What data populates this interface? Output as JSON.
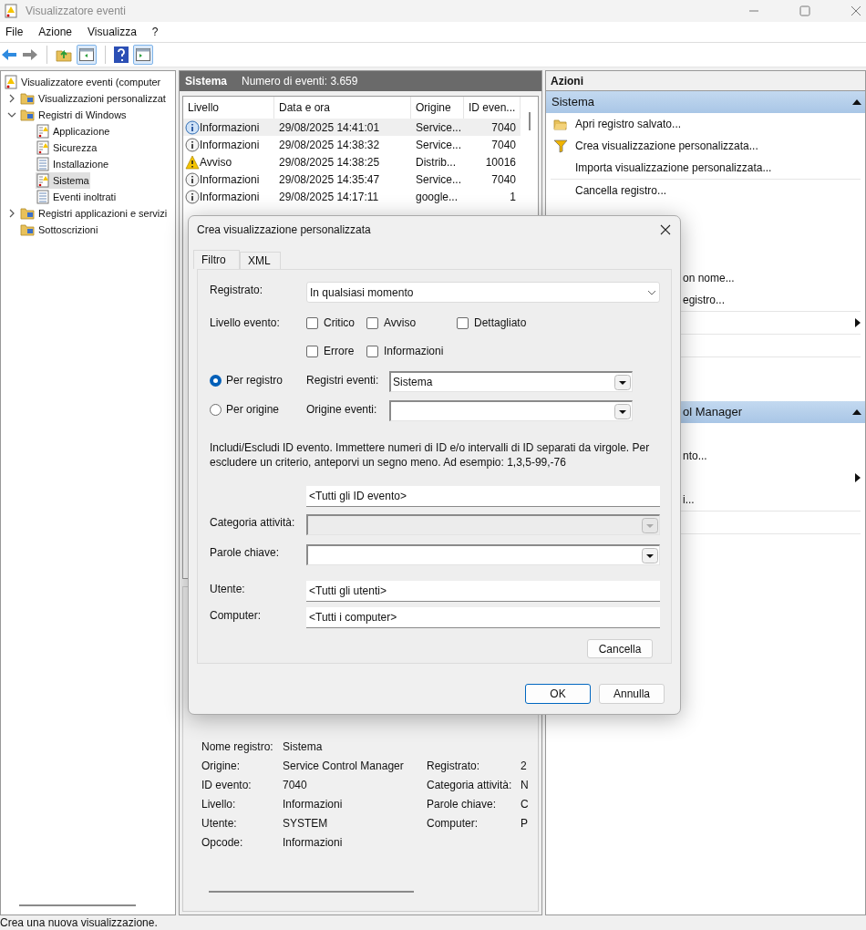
{
  "window": {
    "title": "Visualizzatore eventi"
  },
  "menu": [
    "File",
    "Azione",
    "Visualizza",
    "?"
  ],
  "toolbar": [
    {
      "kind": "back"
    },
    {
      "kind": "forward"
    },
    {
      "kind": "sep"
    },
    {
      "kind": "up"
    },
    {
      "kind": "pane-left",
      "selected": true
    },
    {
      "kind": "sep"
    },
    {
      "kind": "help"
    },
    {
      "kind": "pane-right",
      "selected": true
    }
  ],
  "tree": [
    {
      "label": "Visualizzatore eventi (computer",
      "kind": "viewer",
      "selected": false,
      "children": [
        {
          "label": "Visualizzazioni personalizzat",
          "kind": "folder",
          "expanded": false,
          "selected": false
        },
        {
          "label": "Registri di Windows",
          "kind": "folder",
          "expanded": true,
          "selected": false,
          "children": [
            {
              "label": "Applicazione",
              "kind": "log-warn",
              "selected": false
            },
            {
              "label": "Sicurezza",
              "kind": "log-warn",
              "selected": false
            },
            {
              "label": "Installazione",
              "kind": "log",
              "selected": false
            },
            {
              "label": "Sistema",
              "kind": "log-warn",
              "selected": true
            },
            {
              "label": "Eventi inoltrati",
              "kind": "log",
              "selected": false
            }
          ]
        },
        {
          "label": "Registri applicazioni e servizi",
          "kind": "folder",
          "expanded": false,
          "selected": false
        },
        {
          "label": "Sottoscrizioni",
          "kind": "folder",
          "selected": false
        }
      ]
    }
  ],
  "log_header": {
    "title": "Sistema",
    "count": "Numero di eventi: 3.659"
  },
  "events": {
    "columns": [
      "Livello",
      "Data e ora",
      "Origine",
      "ID even..."
    ],
    "rows": [
      {
        "kind": "info",
        "level": "Informazioni",
        "date": "29/08/2025 14:41:01",
        "source": "Service...",
        "id": "7040",
        "selected": true
      },
      {
        "kind": "info",
        "level": "Informazioni",
        "date": "29/08/2025 14:38:32",
        "source": "Service...",
        "id": "7040",
        "selected": false
      },
      {
        "kind": "warning",
        "level": "Avviso",
        "date": "29/08/2025 14:38:25",
        "source": "Distrib...",
        "id": "10016",
        "selected": false
      },
      {
        "kind": "info",
        "level": "Informazioni",
        "date": "29/08/2025 14:35:47",
        "source": "Service...",
        "id": "7040",
        "selected": false
      },
      {
        "kind": "info",
        "level": "Informazioni",
        "date": "29/08/2025 14:17:11",
        "source": "google...",
        "id": "1",
        "selected": false
      }
    ]
  },
  "details": {
    "left": [
      {
        "label": "Nome registro:",
        "value": "Sistema"
      },
      {
        "label": "Origine:",
        "value": "Service Control Manager"
      },
      {
        "label": "ID evento:",
        "value": "7040"
      },
      {
        "label": "Livello:",
        "value": "Informazioni"
      },
      {
        "label": "Utente:",
        "value": "SYSTEM"
      },
      {
        "label": "Opcode:",
        "value": "Informazioni"
      }
    ],
    "right": [
      {
        "label": "Registrato:",
        "value": "2"
      },
      {
        "label": "Categoria attività:",
        "value": "N"
      },
      {
        "label": "Parole chiave:",
        "value": "C"
      },
      {
        "label": "Computer:",
        "value": "P"
      }
    ]
  },
  "actions": {
    "title": "Azioni",
    "sections": [
      {
        "title": "Sistema",
        "partial": false,
        "expanded": true,
        "items": [
          {
            "kind": "open",
            "label": "Apri registro salvato..."
          },
          {
            "kind": "filter",
            "label": "Crea visualizzazione personalizzata..."
          },
          {
            "kind": "action",
            "label": "Importa visualizzazione personalizzata..."
          },
          {
            "kind": "divider"
          },
          {
            "kind": "action",
            "label": "Cancella registro..."
          },
          {
            "kind": "blank"
          },
          {
            "kind": "blank"
          },
          {
            "kind": "blank"
          },
          {
            "kind": "partial",
            "label": "on nome..."
          },
          {
            "kind": "partial",
            "label": "egistro..."
          },
          {
            "kind": "divider"
          },
          {
            "kind": "submenu"
          },
          {
            "kind": "divider"
          },
          {
            "kind": "blank"
          },
          {
            "kind": "divider"
          },
          {
            "kind": "blank"
          }
        ]
      },
      {
        "title": "ol Manager",
        "partial": true,
        "expanded": true,
        "items": [
          {
            "kind": "blank"
          },
          {
            "kind": "partial",
            "label": "nto..."
          },
          {
            "kind": "submenu"
          },
          {
            "kind": "partial",
            "label": "i..."
          },
          {
            "kind": "divider"
          },
          {
            "kind": "blank"
          },
          {
            "kind": "divider"
          }
        ]
      }
    ]
  },
  "dialog": {
    "title": "Crea visualizzazione personalizzata",
    "tabs": [
      {
        "label": "Filtro",
        "selected": true
      },
      {
        "label": "XML",
        "selected": false
      }
    ],
    "logged": {
      "label": "Registrato:",
      "value": "In qualsiasi momento"
    },
    "level_label": "Livello evento:",
    "levels": [
      {
        "label": "Critico",
        "checked": false
      },
      {
        "label": "Avviso",
        "checked": false
      },
      {
        "label": "Dettagliato",
        "checked": false
      },
      {
        "label": "Errore",
        "checked": false
      },
      {
        "label": "Informazioni",
        "checked": false
      }
    ],
    "sources": [
      {
        "label": "Per registro",
        "selected": true,
        "field_label": "Registri eventi:",
        "value": "Sistema"
      },
      {
        "label": "Per origine",
        "selected": false,
        "field_label": "Origine eventi:"
      }
    ],
    "help": "Includi/Escludi ID evento. Immettere numeri di ID e/o intervalli di ID separati da virgole. Per escludere un criterio, anteporvi un segno meno. Ad esempio: 1,3,5-99,-76",
    "event_ids": {
      "value": "<Tutti gli ID evento>"
    },
    "category": {
      "label": "Categoria attività:",
      "disabled": true
    },
    "keywords": {
      "label": "Parole chiave:",
      "disabled": false
    },
    "user": {
      "label": "Utente:",
      "value": "<Tutti gli utenti>"
    },
    "computer": {
      "label": "Computer:",
      "value": "<Tutti i computer>"
    },
    "clear_button": "Cancella",
    "buttons": [
      {
        "label": "OK",
        "default": true
      },
      {
        "label": "Annulla",
        "default": false
      }
    ]
  },
  "status_bar": "Crea una nuova visualizzazione."
}
